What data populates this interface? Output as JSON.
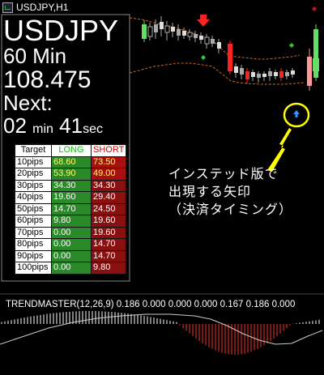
{
  "window": {
    "title": "USDJPY,H1"
  },
  "info": {
    "symbol": "USDJPY",
    "timeframe": "60 Min",
    "price": "108.475",
    "next_label": "Next:",
    "minutes": "02",
    "min_unit": "min",
    "seconds": "41",
    "sec_unit": "sec"
  },
  "pip_table": {
    "headers": [
      "Target",
      "LONG",
      "SHORT"
    ],
    "rows": [
      {
        "target": "10pips",
        "long": "68.60",
        "short": "73.50"
      },
      {
        "target": "20pips",
        "long": "53.90",
        "short": "49.00"
      },
      {
        "target": "30pips",
        "long": "34.30",
        "short": "34.30"
      },
      {
        "target": "40pips",
        "long": "19.60",
        "short": "29.40"
      },
      {
        "target": "50pips",
        "long": "14.70",
        "short": "24.50"
      },
      {
        "target": "60pips",
        "long": "9.80",
        "short": "19.60"
      },
      {
        "target": "70pips",
        "long": "0.00",
        "short": "19.60"
      },
      {
        "target": "80pips",
        "long": "0.00",
        "short": "14.70"
      },
      {
        "target": "90pips",
        "long": "0.00",
        "short": "14.70"
      },
      {
        "target": "100pips",
        "long": "0.00",
        "short": "9.80"
      }
    ]
  },
  "oscillator": {
    "label": "TRENDMASTER(12,26,9) 0.186 0.000 0.000 0.000 0.167 0.186 0.000"
  },
  "annotation": {
    "lines": [
      "インステッド版で",
      "出現する矢印",
      "（決済タイミング）"
    ]
  },
  "icons": {
    "corner": "close-marker-icon",
    "signal": "up-arrow-icon"
  },
  "colors": {
    "bull": "#e8e8e8",
    "bear": "#ff2020",
    "green_candle": "#66dd66",
    "highlight": "#ffff00",
    "signal_arrow": "#3399ff"
  }
}
